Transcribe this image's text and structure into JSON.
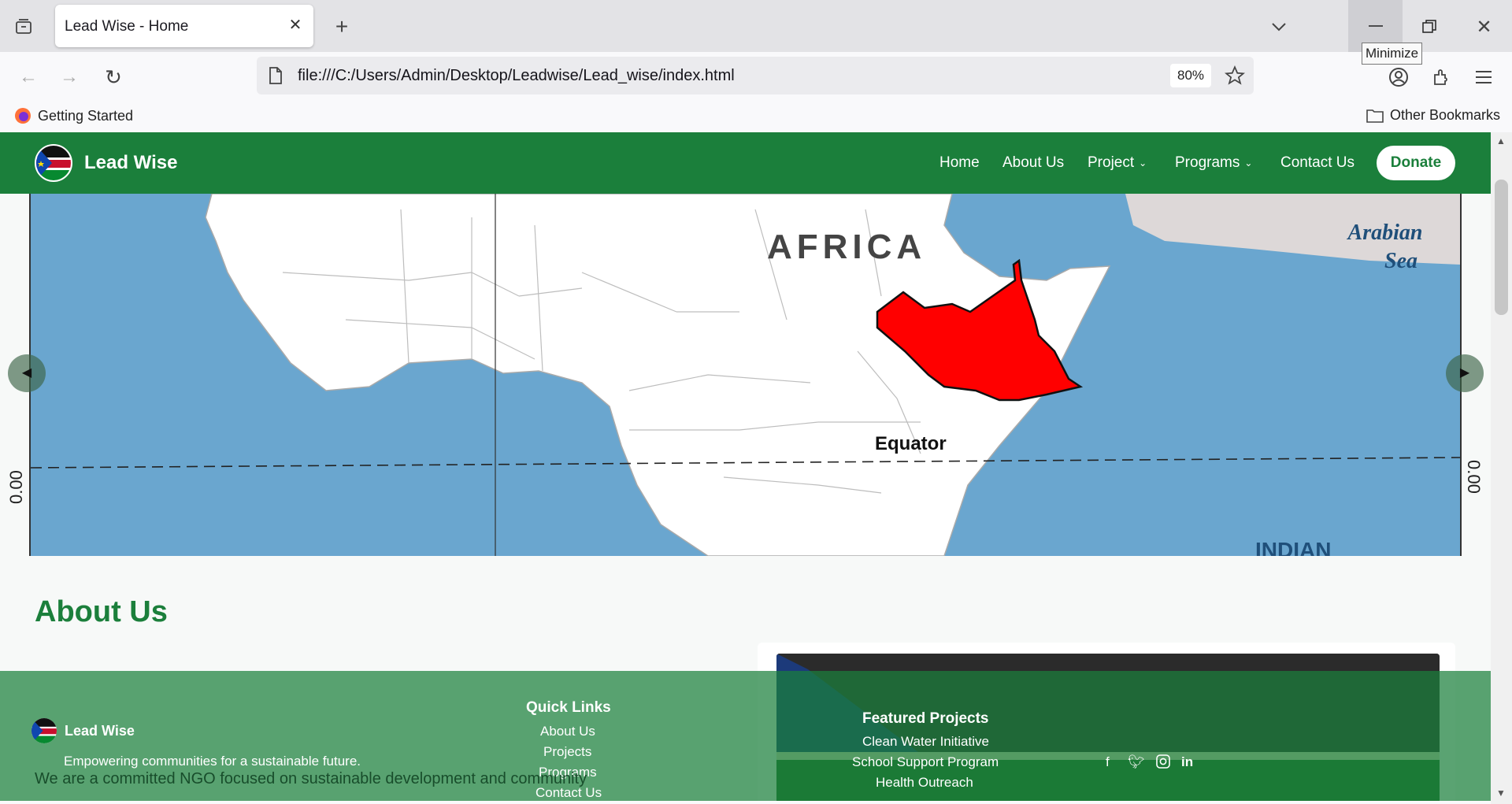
{
  "browser": {
    "tab_title": "Lead Wise - Home",
    "url": "file:///C:/Users/Admin/Desktop/Leadwise/Lead_wise/index.html",
    "zoom": "80%",
    "tooltip": "Minimize",
    "bookmarks": [
      {
        "label": "Getting Started"
      },
      {
        "label": "Other Bookmarks"
      }
    ]
  },
  "site": {
    "brand": "Lead Wise",
    "nav": [
      {
        "label": "Home"
      },
      {
        "label": "About Us"
      },
      {
        "label": "Project"
      },
      {
        "label": "Programs"
      },
      {
        "label": "Contact Us"
      }
    ],
    "donate_label": "Donate",
    "accent_color": "#1b7f3b"
  },
  "hero": {
    "map_labels": {
      "continent": "AFRICA",
      "sea": "Arabian Sea",
      "equator": "Equator",
      "ocean": "INDIAN",
      "latitude": "0.00"
    },
    "slides": 4,
    "active_slide": 2
  },
  "about": {
    "title": "About Us",
    "paragraph": "We are a committed NGO focused on sustainable development and community"
  },
  "footer": {
    "brand": "Lead Wise",
    "tagline": "Empowering communities for a sustainable future.",
    "quick_links_title": "Quick Links",
    "quick_links": [
      {
        "label": "About Us"
      },
      {
        "label": "Projects"
      },
      {
        "label": "Programs"
      },
      {
        "label": "Contact Us"
      }
    ],
    "featured_title": "Featured Projects",
    "featured": [
      {
        "label": "Clean Water Initiative"
      },
      {
        "label": "School Support Program"
      },
      {
        "label": "Health Outreach"
      }
    ],
    "social_icons": [
      "facebook-icon",
      "twitter-icon",
      "instagram-icon",
      "linkedin-icon"
    ]
  }
}
